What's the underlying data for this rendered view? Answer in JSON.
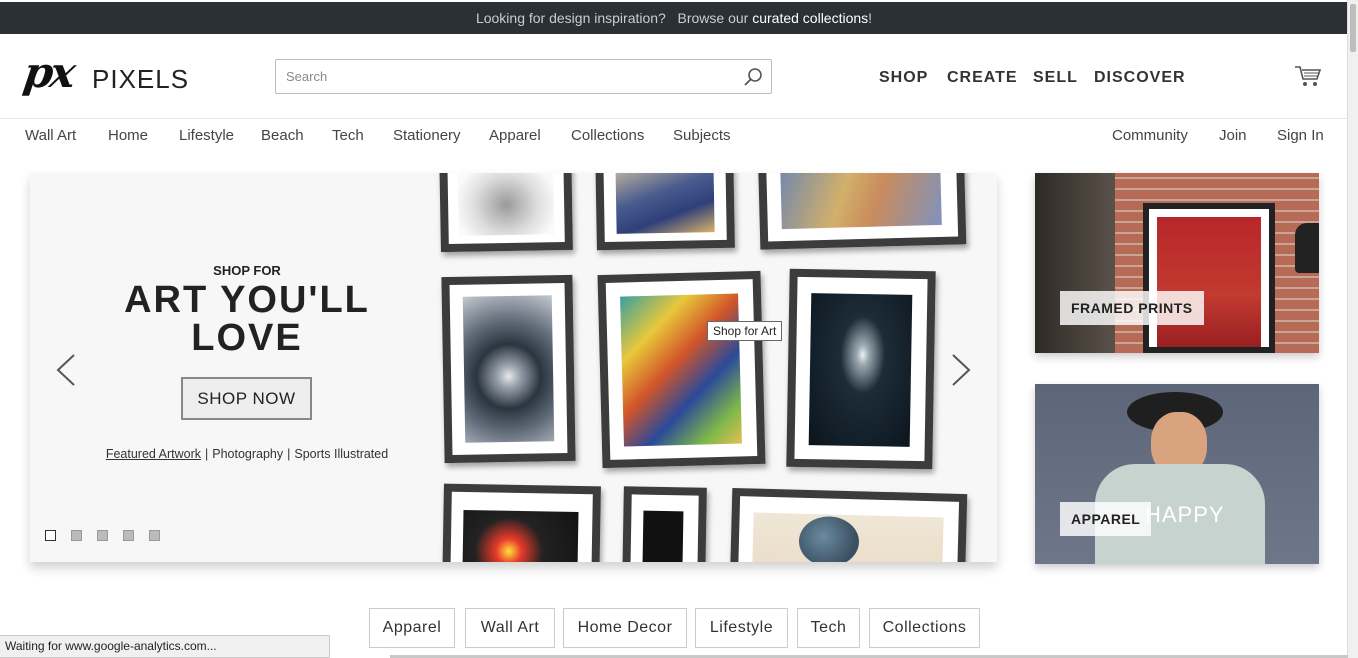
{
  "promo": {
    "text": "Looking for design inspiration?   Browse our ",
    "link": "curated collections",
    "end": "!"
  },
  "header": {
    "logo_mark": "px",
    "logo_text": "PIXELS",
    "search": {
      "placeholder": "Search",
      "value": ""
    },
    "nav": [
      "SHOP",
      "CREATE",
      "SELL",
      "DISCOVER"
    ]
  },
  "subnav": {
    "left": [
      "Wall Art",
      "Home",
      "Lifestyle",
      "Beach",
      "Tech",
      "Stationery",
      "Apparel",
      "Collections",
      "Subjects"
    ],
    "right": [
      "Community",
      "Join",
      "Sign In"
    ]
  },
  "hero": {
    "kicker": "SHOP FOR",
    "headline_1": "ART YOU'LL",
    "headline_2": "LOVE",
    "button": "SHOP NOW",
    "links": [
      "Featured Artwork",
      "Photography",
      "Sports Illustrated"
    ],
    "separator": "|",
    "tooltip": "Shop for Art",
    "slide_count": 5,
    "active_slide": 1
  },
  "tiles": [
    {
      "label": "FRAMED PRINTS"
    },
    {
      "label": "APPAREL",
      "shirt_text": "HAPPY"
    }
  ],
  "categories": [
    "Apparel",
    "Wall Art",
    "Home Decor",
    "Lifestyle",
    "Tech",
    "Collections"
  ],
  "status_bar": "Waiting for www.google-analytics.com...",
  "colors": {
    "promo_bg": "#2a3036",
    "frame": "#3c3c3c",
    "accent_text": "#222222"
  },
  "icons": [
    "search-icon",
    "cart-icon",
    "chevron-left-icon",
    "chevron-right-icon"
  ]
}
